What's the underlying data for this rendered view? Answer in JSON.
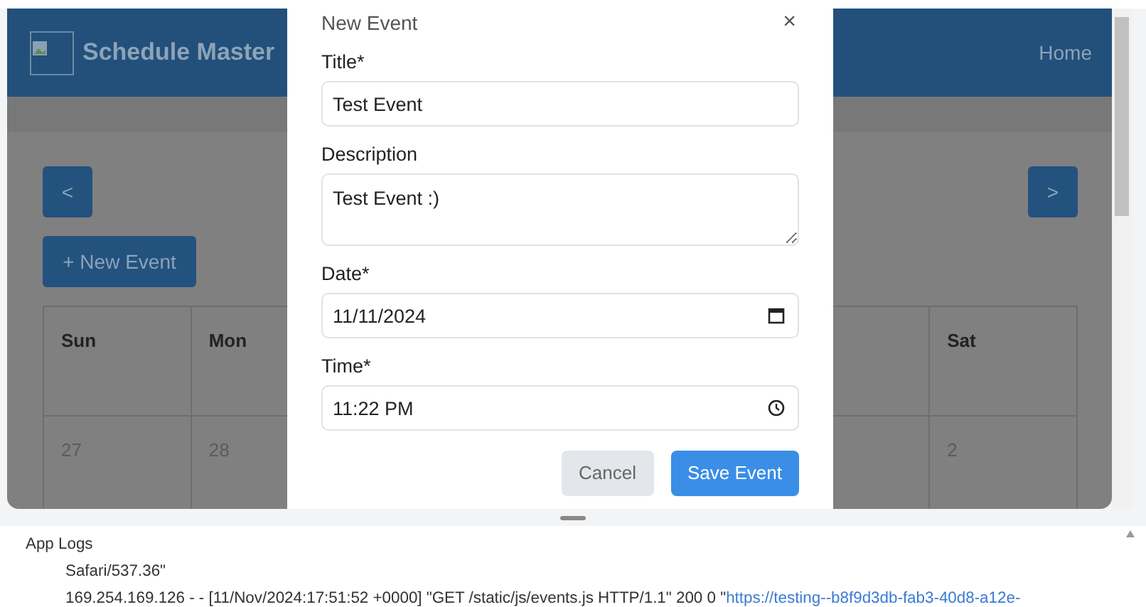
{
  "app": {
    "brand": "Schedule Master",
    "nav_links": [
      {
        "label": "Home"
      }
    ],
    "prev_button": "<",
    "next_button": ">",
    "new_event_button": "+ New Event",
    "calendar": {
      "columns": [
        {
          "header": "Sun",
          "date": "27"
        },
        {
          "header": "Mon",
          "date": "28"
        },
        {
          "header": "Sat",
          "date": "2"
        }
      ]
    }
  },
  "modal": {
    "title": "New Event",
    "close": "×",
    "fields": [
      {
        "kind": "text",
        "label": "Title*",
        "value": "Test Event"
      },
      {
        "kind": "textarea",
        "label": "Description",
        "value": "Test Event :)"
      },
      {
        "kind": "date",
        "label": "Date*",
        "value": "11/11/2024"
      },
      {
        "kind": "time",
        "label": "Time*",
        "value": "11:22 PM"
      }
    ],
    "buttons": [
      {
        "kind": "secondary",
        "label": "Cancel"
      },
      {
        "kind": "primary",
        "label": "Save Event"
      }
    ]
  },
  "logs": {
    "title": "App Logs",
    "lines": [
      {
        "text": "Safari/537.36\""
      },
      {
        "text": "169.254.169.126 - - [11/Nov/2024:17:51:52 +0000] \"GET /static/js/events.js HTTP/1.1\" 200 0 \"",
        "link": "https://testing--b8f9d3db-fab3-40d8-a12e-"
      }
    ]
  }
}
